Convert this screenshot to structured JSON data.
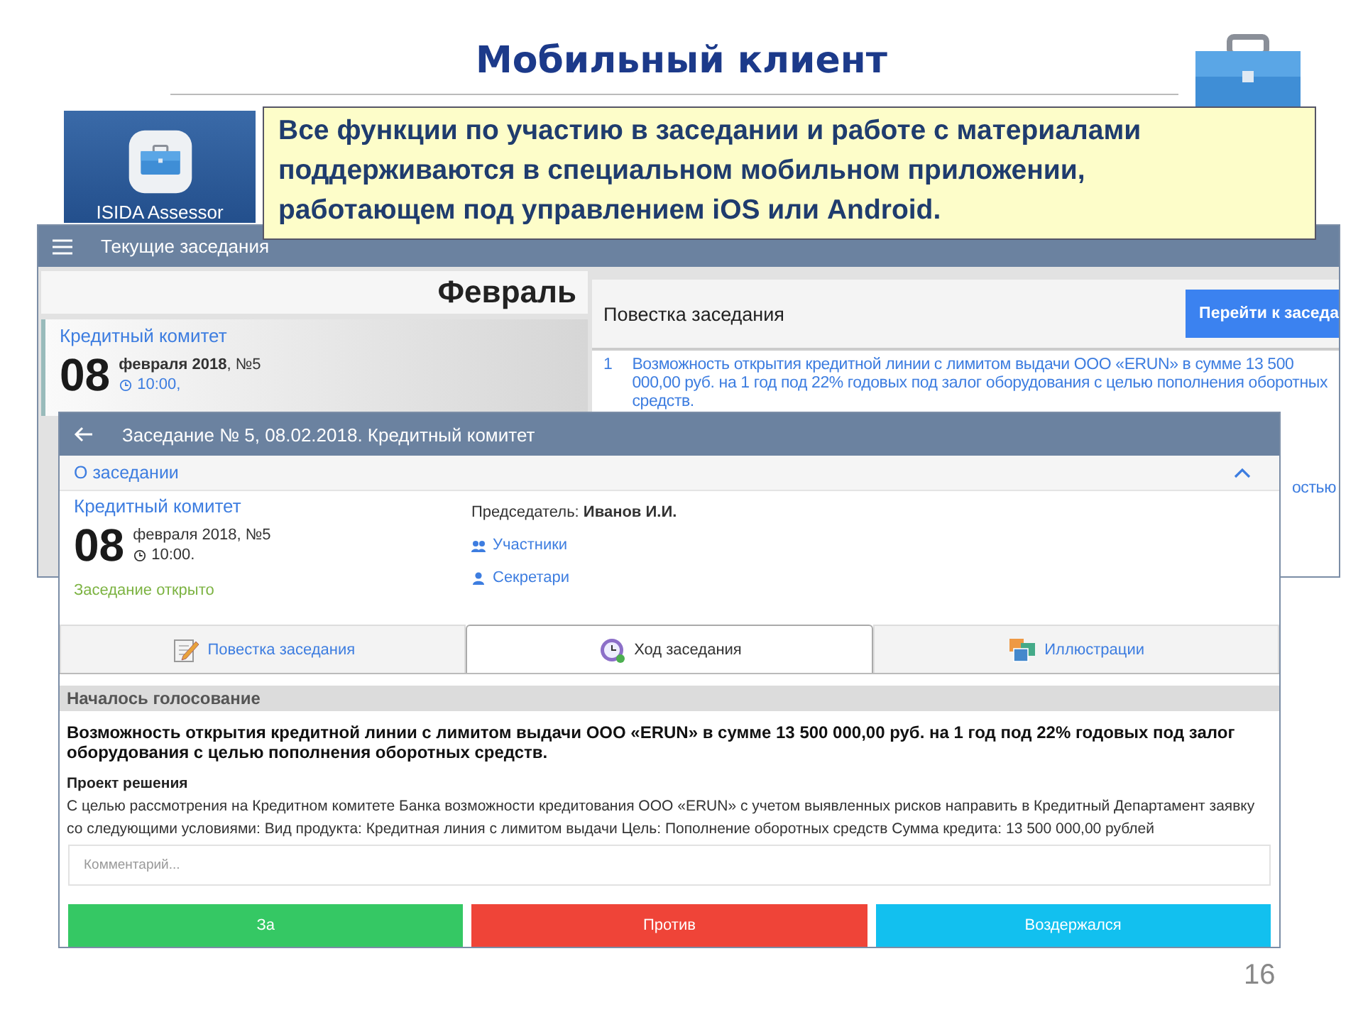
{
  "slide": {
    "title": "Мобильный клиент",
    "callout": "Все функции по участию в заседании и работе с материалами поддерживаются в специальном мобильном приложении, работающем под управлением iOS или Android.",
    "page_number": "16"
  },
  "app_tile": {
    "label": "ISIDA Assessor"
  },
  "meetings_screen": {
    "title": "Текущие заседания",
    "month": "Февраль",
    "meeting": {
      "committee": "Кредитный комитет",
      "day": "08",
      "date": "**февраля 2018**, №5",
      "time": "10:00,"
    },
    "agenda_title": "Повестка заседания",
    "go_button": "Перейти к заседа",
    "agenda_items": [
      {
        "number": "1",
        "text": "Возможность открытия кредитной линии с лимитом выдачи ООО «ERUN» в сумме 13 500 000,00 руб. на 1 год под 22% годовых под залог оборудования с целью пополнения оборотных средств."
      },
      {
        "text": "остью"
      }
    ]
  },
  "meeting_screen": {
    "title": "Заседание № 5, 08.02.2018. Кредитный комитет",
    "section": {
      "title": "О заседании",
      "expanded": true
    },
    "committee": "Кредитный комитет",
    "day": "08",
    "date": "февраля 2018, №5",
    "time": "10:00.",
    "status": "Заседание открыто",
    "chair": "Председатель: **Иванов И.И.**",
    "links": [
      {
        "label": "Участники",
        "kind": "group"
      },
      {
        "label": "Секретари",
        "kind": "person"
      }
    ],
    "tabs": [
      {
        "label": "Повестка заседания",
        "kind": "agenda",
        "selected": false
      },
      {
        "label": "Ход заседания",
        "kind": "progress",
        "selected": true
      },
      {
        "label": "Иллюстрации",
        "kind": "pictures",
        "selected": false
      }
    ],
    "voting": {
      "header": "Началось голосование",
      "question": "Возможность открытия кредитной линии с лимитом выдачи ООО «ERUN» в сумме 13 500 000,00 руб. на 1 год под 22% годовых под залог оборудования с целью пополнения оборотных средств.",
      "draft_title": "Проект решения",
      "draft": "С целью рассмотрения на Кредитном комитете Банка возможности кредитования ООО «ERUN» с учетом выявленных рисков направить в Кредитный Департамент заявку со следующими условиями: Вид продукта: Кредитная линия с лимитом выдачи Цель: Пополнение оборотных средств Сумма кредита: 13 500 000,00 рублей",
      "comment_placeholder": "Комментарий...",
      "buttons": [
        {
          "label": "За",
          "kind": "for"
        },
        {
          "label": "Против",
          "kind": "against"
        },
        {
          "label": "Воздержался",
          "kind": "abstain"
        }
      ]
    }
  }
}
